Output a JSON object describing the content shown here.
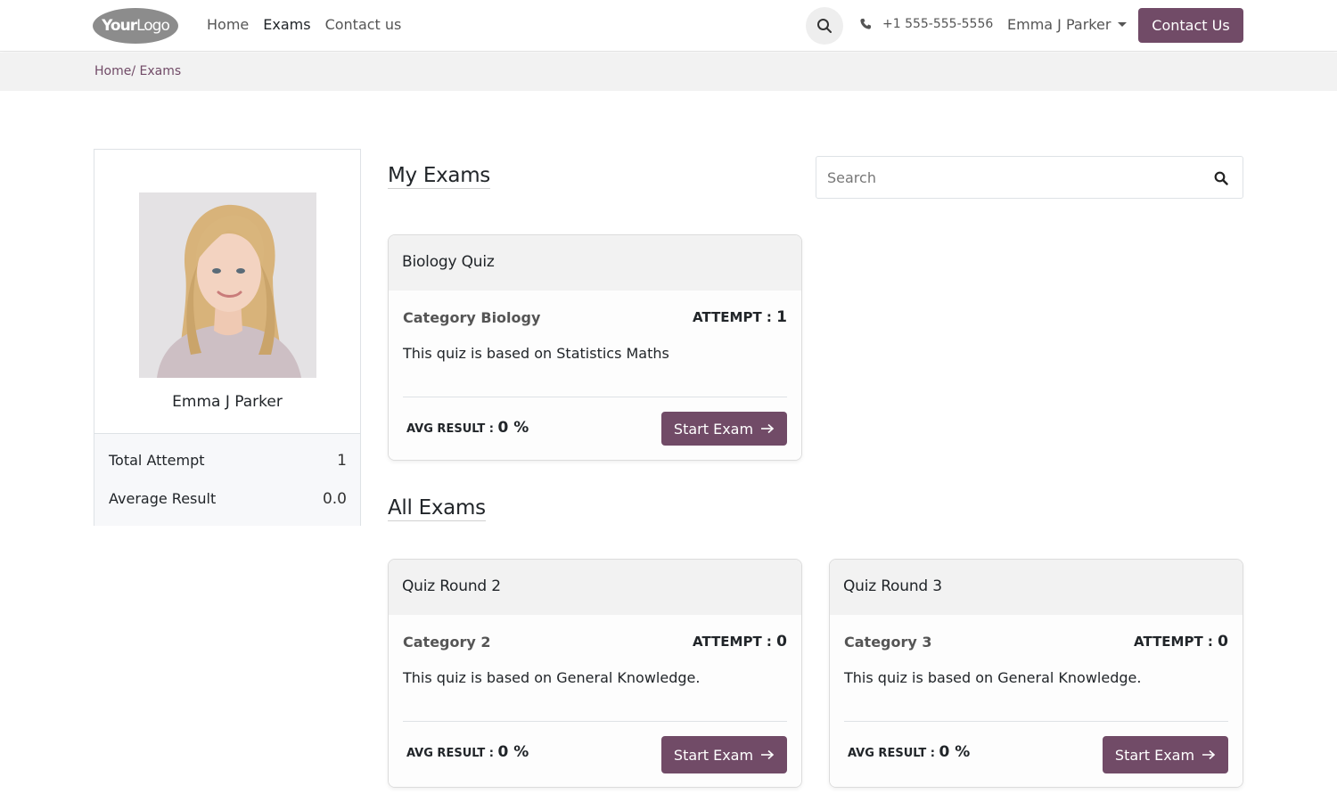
{
  "header": {
    "logo_part1": "Your",
    "logo_part2": "Logo",
    "nav": [
      {
        "label": "Home",
        "active": false
      },
      {
        "label": "Exams",
        "active": true
      },
      {
        "label": "Contact us",
        "active": false
      }
    ],
    "search_icon": "search-icon",
    "phone_icon": "phone-icon",
    "phone": "+1 555-555-5556",
    "user_name": "Emma J Parker",
    "contact_button": "Contact Us"
  },
  "breadcrumb": "Home/ Exams",
  "profile": {
    "name": "Emma J Parker",
    "stats": [
      {
        "label": "Total Attempt",
        "value": "1"
      },
      {
        "label": "Average Result",
        "value": "0.0"
      }
    ]
  },
  "my_exams": {
    "title": "My Exams",
    "search_placeholder": "Search",
    "cards": [
      {
        "title": "Biology Quiz",
        "category": "Category Biology",
        "attempt_label": "ATTEMPT : ",
        "attempt_value": "1",
        "description": "This quiz is based on Statistics Maths",
        "avg_label": "AVG RESULT : ",
        "avg_value": "0 %",
        "button": "Start Exam"
      }
    ]
  },
  "all_exams": {
    "title": "All Exams",
    "cards": [
      {
        "title": "Quiz Round 2",
        "category": "Category 2",
        "attempt_label": "ATTEMPT : ",
        "attempt_value": "0",
        "description": "This quiz is based on General Knowledge.",
        "avg_label": "AVG RESULT : ",
        "avg_value": "0 %",
        "button": "Start Exam"
      },
      {
        "title": "Quiz Round 3",
        "category": "Category 3",
        "attempt_label": "ATTEMPT : ",
        "attempt_value": "0",
        "description": "This quiz is based on General Knowledge.",
        "avg_label": "AVG RESULT : ",
        "avg_value": "0 %",
        "button": "Start Exam"
      }
    ]
  },
  "colors": {
    "brand": "#714b67",
    "header_bg": "#ffffff",
    "breadcrumb_bg": "#f2f2f2"
  }
}
